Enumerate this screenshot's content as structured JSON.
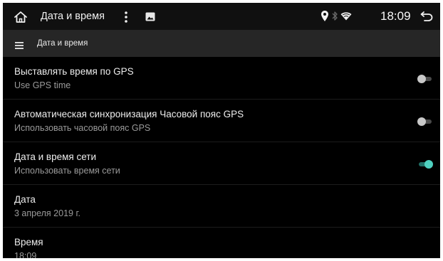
{
  "colors": {
    "background": "#000000",
    "status_bar": "#101010",
    "toolbar": "#262626",
    "title_text": "#ededed",
    "summary_text": "#9a9a9a",
    "accent": "#4fd1c0",
    "toggle_off": "#c8c8c8"
  },
  "status_bar": {
    "title": "Дата и время",
    "time": "18:09",
    "icons": [
      "home-icon",
      "overflow-icon",
      "gallery-icon",
      "location-icon",
      "bluetooth-icon",
      "wifi-icon",
      "back-icon"
    ]
  },
  "toolbar": {
    "icon": "menu-icon",
    "title": "Дата и время"
  },
  "settings": [
    {
      "title": "Выставлять время по GPS",
      "summary": "Use GPS time",
      "toggle": "off"
    },
    {
      "title": "Автоматическая синхронизация Часовой пояс GPS",
      "summary": "Использовать часовой пояс GPS",
      "toggle": "off"
    },
    {
      "title": "Дата и время сети",
      "summary": "Использовать время сети",
      "toggle": "on"
    },
    {
      "title": "Дата",
      "summary": "3 апреля 2019 г."
    },
    {
      "title": "Время",
      "summary": "18:09"
    }
  ]
}
